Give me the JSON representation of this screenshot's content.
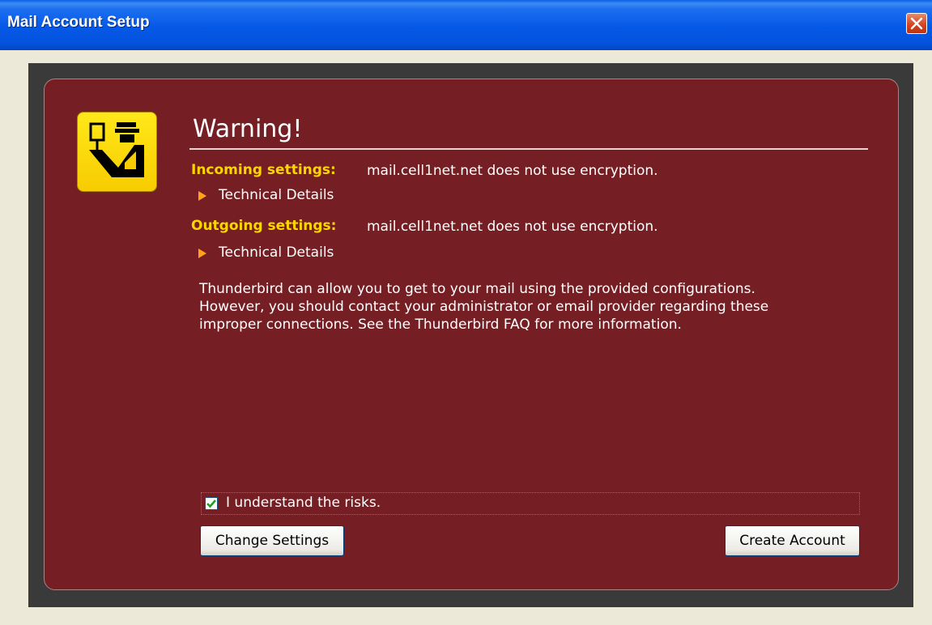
{
  "window": {
    "title": "Mail Account Setup"
  },
  "warning": {
    "heading": "Warning!",
    "incoming": {
      "label": "Incoming settings:",
      "message": "mail.cell1net.net does not use encryption."
    },
    "outgoing": {
      "label": "Outgoing settings:",
      "message": "mail.cell1net.net does not use encryption."
    },
    "details_label": "Technical Details",
    "paragraph": [
      "Thunderbird can allow you to get to your mail using the provided configurations.",
      "However, you should contact your administrator or email provider regarding these",
      "improper connections. See the Thunderbird FAQ for more information."
    ],
    "checkbox_label": "I understand the risks.",
    "checkbox_checked": true
  },
  "buttons": {
    "change_settings": "Change Settings",
    "create_account": "Create Account"
  },
  "colors": {
    "panel": "#751f24",
    "label_yellow": "#ffd600",
    "triangle": "#ffa31a",
    "titlebar": "#0558e6"
  }
}
